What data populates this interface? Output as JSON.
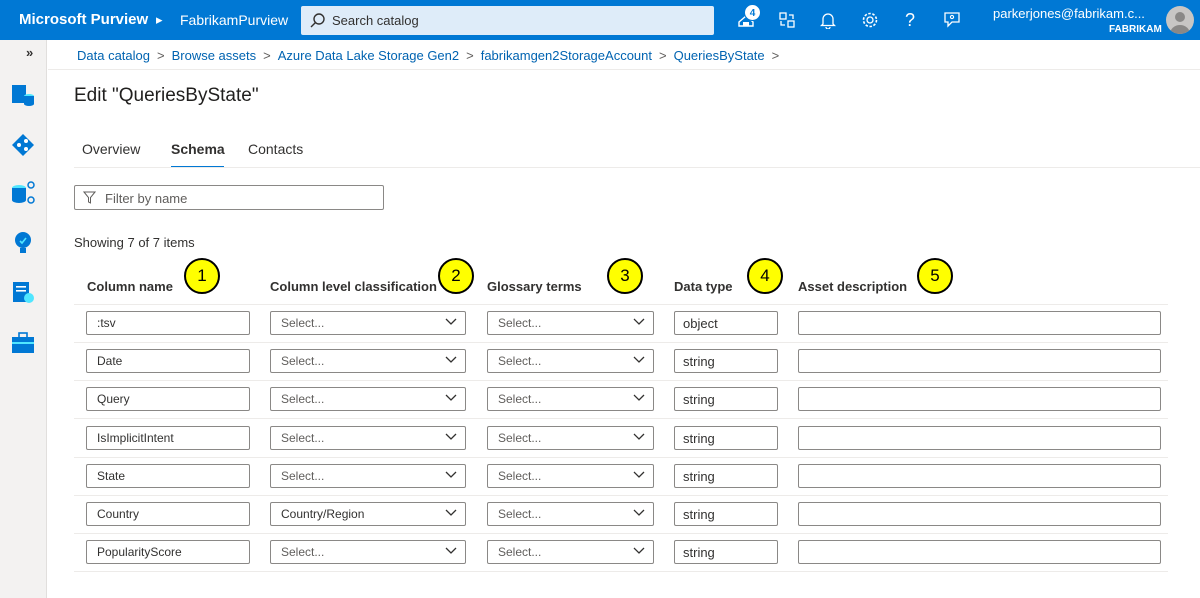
{
  "header": {
    "brand": "Microsoft Purview",
    "tenant": "FabrikamPurview",
    "search_placeholder": "Search catalog",
    "notification_count": "4",
    "user_email": "parkerjones@fabrikam.c...",
    "user_org": "FABRIKAM"
  },
  "rail": {
    "expand": "»",
    "icons": [
      "data-catalog-icon",
      "data-map-icon",
      "data-estate-icon",
      "data-insights-icon",
      "data-policy-icon",
      "management-icon"
    ]
  },
  "breadcrumb": [
    "Data catalog",
    "Browse assets",
    "Azure Data Lake Storage Gen2",
    "fabrikamgen2StorageAccount",
    "QueriesByState"
  ],
  "page": {
    "title": "Edit \"QueriesByState\"",
    "tabs": [
      "Overview",
      "Schema",
      "Contacts"
    ],
    "active_tab": "Schema",
    "filter_placeholder": "Filter by name",
    "showing": "Showing 7 of 7 items"
  },
  "columns": {
    "name": "Column name",
    "classification": "Column level classification",
    "glossary": "Glossary terms",
    "data_type": "Data type",
    "description": "Asset description"
  },
  "callouts": [
    "1",
    "2",
    "3",
    "4",
    "5"
  ],
  "rows": [
    {
      "name": ":tsv",
      "classification": "Select...",
      "glossary": "Select...",
      "data_type": "object",
      "description": ""
    },
    {
      "name": "Date",
      "classification": "Select...",
      "glossary": "Select...",
      "data_type": "string",
      "description": ""
    },
    {
      "name": "Query",
      "classification": "Select...",
      "glossary": "Select...",
      "data_type": "string",
      "description": ""
    },
    {
      "name": "IsImplicitIntent",
      "classification": "Select...",
      "glossary": "Select...",
      "data_type": "string",
      "description": ""
    },
    {
      "name": "State",
      "classification": "Select...",
      "glossary": "Select...",
      "data_type": "string",
      "description": ""
    },
    {
      "name": "Country",
      "classification": "Country/Region",
      "glossary": "Select...",
      "data_type": "string",
      "description": ""
    },
    {
      "name": "PopularityScore",
      "classification": "Select...",
      "glossary": "Select...",
      "data_type": "string",
      "description": ""
    }
  ],
  "colors": {
    "accent": "#0078d4",
    "callout": "#ffff00"
  }
}
